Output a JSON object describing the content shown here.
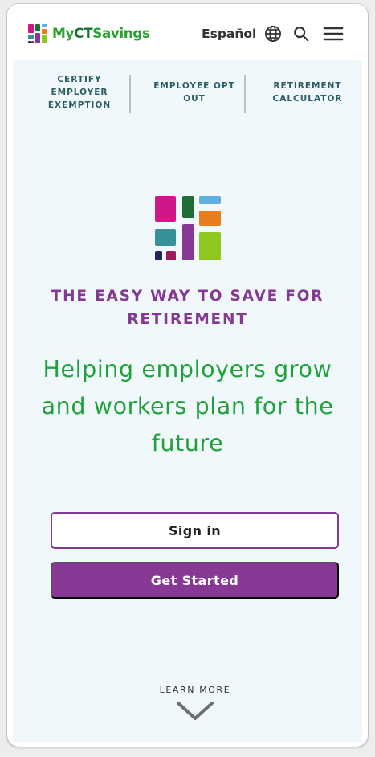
{
  "brand": {
    "logo_name_part1": "My",
    "logo_name_part2": "CT",
    "logo_name_part3": "Savings",
    "colors": {
      "green": "#2ba333",
      "dark_green": "#1e6f36",
      "purple": "#873894",
      "magenta": "#d01787",
      "teal": "#3a9099",
      "orange": "#ea7d1b",
      "sky": "#5fb0e0",
      "lime": "#8ec81f",
      "navy": "#24245c",
      "plum": "#9b1b5a"
    }
  },
  "header": {
    "language_label": "Español",
    "language_icon": "globe-icon",
    "search_icon": "search-icon",
    "menu_icon": "hamburger-menu-icon"
  },
  "quick_links": [
    {
      "label": "CERTIFY EMPLOYER EXEMPTION"
    },
    {
      "label": "EMPLOYEE OPT OUT"
    },
    {
      "label": "RETIREMENT CALCULATOR"
    }
  ],
  "hero": {
    "eyebrow": "THE EASY WAY TO SAVE FOR RETIREMENT",
    "headline": "Helping employers grow and workers plan for the future",
    "sign_in_label": "Sign in",
    "get_started_label": "Get Started",
    "learn_more_label": "LEARN MORE",
    "learn_more_icon": "chevron-down-icon"
  }
}
